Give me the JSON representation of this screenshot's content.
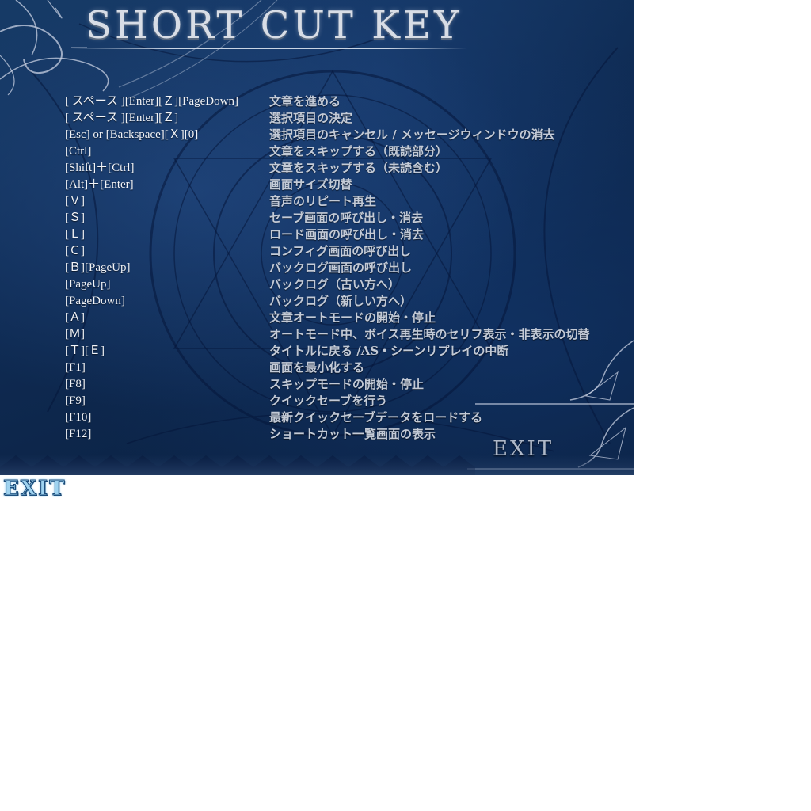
{
  "title": "SHORT CUT KEY",
  "shortcuts": [
    {
      "key": "[ スペース ][Enter][Ｚ][PageDown]",
      "desc": "文章を進める"
    },
    {
      "key": "[ スペース ][Enter][Ｚ]",
      "desc": "選択項目の決定"
    },
    {
      "key": "[Esc] or [Backspace][Ｘ][0]",
      "desc": "選択項目のキャンセル / メッセージウィンドウの消去"
    },
    {
      "key": "[Ctrl]",
      "desc": "文章をスキップする（既読部分）"
    },
    {
      "key": "[Shift]＋[Ctrl]",
      "desc": "文章をスキップする（未読含む）"
    },
    {
      "key": "[Alt]＋[Enter]",
      "desc": "画面サイズ切替"
    },
    {
      "key": "[Ｖ]",
      "desc": "音声のリピート再生"
    },
    {
      "key": "[Ｓ]",
      "desc": "セーブ画面の呼び出し・消去"
    },
    {
      "key": "[Ｌ]",
      "desc": "ロード画面の呼び出し・消去"
    },
    {
      "key": "[Ｃ]",
      "desc": "コンフィグ画面の呼び出し"
    },
    {
      "key": "[Ｂ][PageUp]",
      "desc": "バックログ画面の呼び出し"
    },
    {
      "key": "[PageUp]",
      "desc": "バックログ（古い方へ）"
    },
    {
      "key": "[PageDown]",
      "desc": "バックログ（新しい方へ）"
    },
    {
      "key": "[Ａ]",
      "desc": "文章オートモードの開始・停止"
    },
    {
      "key": "[Ｍ]",
      "desc": "オートモード中、ボイス再生時のセリフ表示・非表示の切替"
    },
    {
      "key": "[Ｔ][Ｅ]",
      "desc": "タイトルに戻る /AS・シーンリプレイの中断"
    },
    {
      "key": "[F1]",
      "desc": "画面を最小化する"
    },
    {
      "key": "[F8]",
      "desc": "スキップモードの開始・停止"
    },
    {
      "key": "[F9]",
      "desc": "クイックセーブを行う"
    },
    {
      "key": "[F10]",
      "desc": "最新クイックセーブデータをロードする"
    },
    {
      "key": "[F12]",
      "desc": "ショートカット一覧画面の表示"
    }
  ],
  "exit_panel_label": "EXIT",
  "exit_button_label": "EXIT",
  "colors": {
    "background": "#0f2c55",
    "key_text": "#f2f4f8",
    "desc_text": "#c3cad6",
    "exit_button": "#9fd3f0"
  }
}
